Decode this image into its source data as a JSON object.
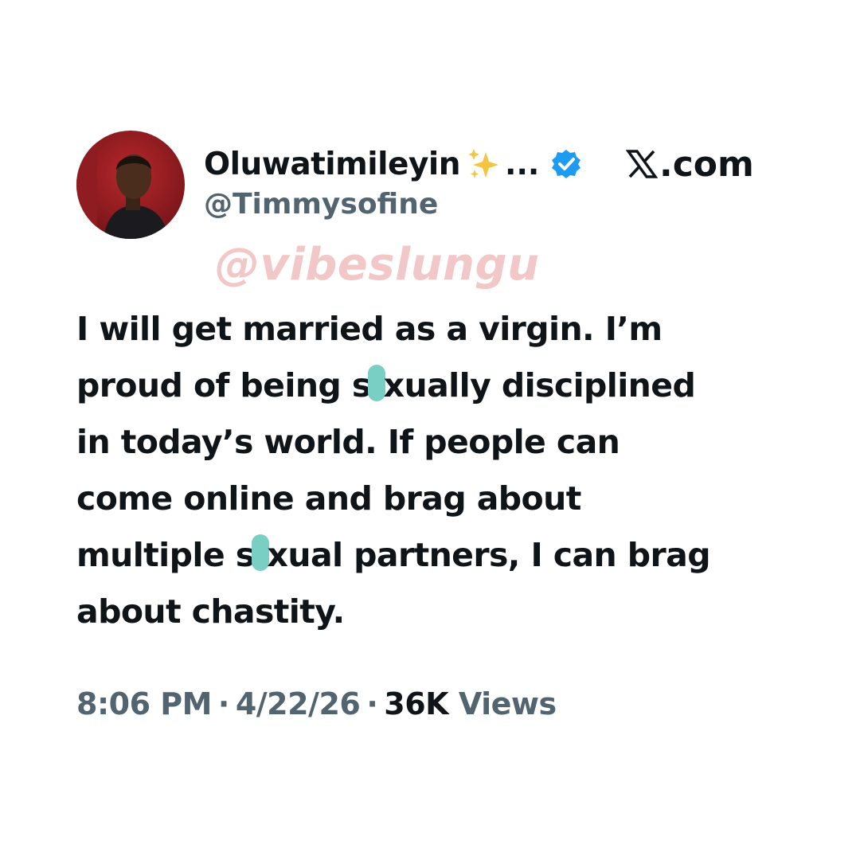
{
  "tweet": {
    "author_name": "Oluwatimileyin",
    "name_truncation": "...",
    "author_handle": "@Timmysofine",
    "site_label": ".com",
    "watermark": "@vibeslungu",
    "text_lines": [
      [
        "I will get married as a virgin. I’m"
      ],
      [
        "proud of being s",
        "xually disciplined"
      ],
      [
        "in today’s world. If people can"
      ],
      [
        "come online and brag about"
      ],
      [
        "multiple s",
        "xual partners, I can brag"
      ],
      [
        "about chastity."
      ]
    ],
    "time": "8:06 PM",
    "date": "4/22/26",
    "separator": "·",
    "views_count": "36K",
    "views_label": "Views"
  },
  "icons": {
    "avatar": "profile-photo",
    "sparkle": "sparkles-emoji-icon",
    "verified": "verified-badge-icon",
    "logo": "x-logo-icon",
    "censor": "censor-dot"
  },
  "colors": {
    "text_primary": "#0f1419",
    "text_secondary": "#536471",
    "verified_blue": "#1d9bf0",
    "watermark_pink": "#f2c7c7",
    "censor_teal": "#79cfc3"
  }
}
